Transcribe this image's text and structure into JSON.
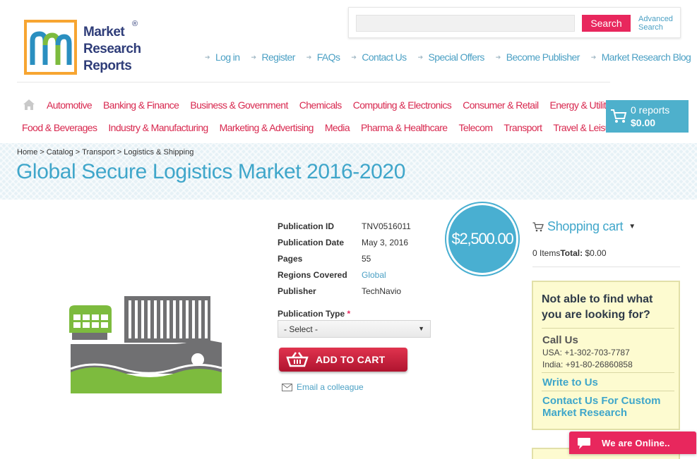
{
  "logo": {
    "line1": "Market",
    "line2": "Research",
    "line3": "Reports",
    "reg": "®"
  },
  "search": {
    "placeholder": "",
    "button": "Search",
    "advanced_line1": "Advanced",
    "advanced_line2": "Search"
  },
  "toplinks": [
    "Log in",
    "Register",
    "FAQs",
    "Contact Us",
    "Special Offers",
    "Become Publisher",
    "Market Research Blog"
  ],
  "nav": {
    "row1": [
      "Automotive",
      "Banking & Finance",
      "Business & Government",
      "Chemicals",
      "Computing & Electronics",
      "Consumer & Retail",
      "Energy & Utilities"
    ],
    "row2": [
      "Food & Beverages",
      "Industry & Manufacturing",
      "Marketing & Advertising",
      "Media",
      "Pharma & Healthcare",
      "Telecom",
      "Transport",
      "Travel & Leisure"
    ]
  },
  "cart": {
    "count": "0 reports",
    "total": "$0.00"
  },
  "breadcrumb": [
    "Home",
    "Catalog",
    "Transport",
    "Logistics & Shipping"
  ],
  "breadcrumb_sep": ">",
  "title": "Global Secure Logistics Market 2016-2020",
  "details": {
    "pub_id_label": "Publication ID",
    "pub_id": "TNV0516011",
    "pub_date_label": "Publication Date",
    "pub_date": "May 3, 2016",
    "pages_label": "Pages",
    "pages": "55",
    "regions_label": "Regions Covered",
    "regions": "Global",
    "publisher_label": "Publisher",
    "publisher": "TechNavio"
  },
  "pub_type": {
    "label": "Publication Type",
    "required": "*",
    "selected": "- Select -"
  },
  "add_to_cart": "ADD TO CART",
  "email_colleague": "Email a colleague",
  "price": "$2,500.00",
  "shopping_cart": {
    "title": "Shopping cart",
    "items": "0 Items",
    "total_label": "Total:",
    "total": "$0.00"
  },
  "help": {
    "title": "Not able to find what you are looking for?",
    "call_us": "Call Us",
    "usa": "USA: +1-302-703-7787",
    "india": "India: +91-80-26860858",
    "write_us": "Write to Us",
    "custom": "Contact Us For Custom Market Research"
  },
  "online": "We are Online..",
  "colors": {
    "accent_pink": "#e8275d",
    "accent_blue": "#3fa6ca",
    "nav_red": "#d8284f",
    "logo_orange": "#f7a531"
  }
}
